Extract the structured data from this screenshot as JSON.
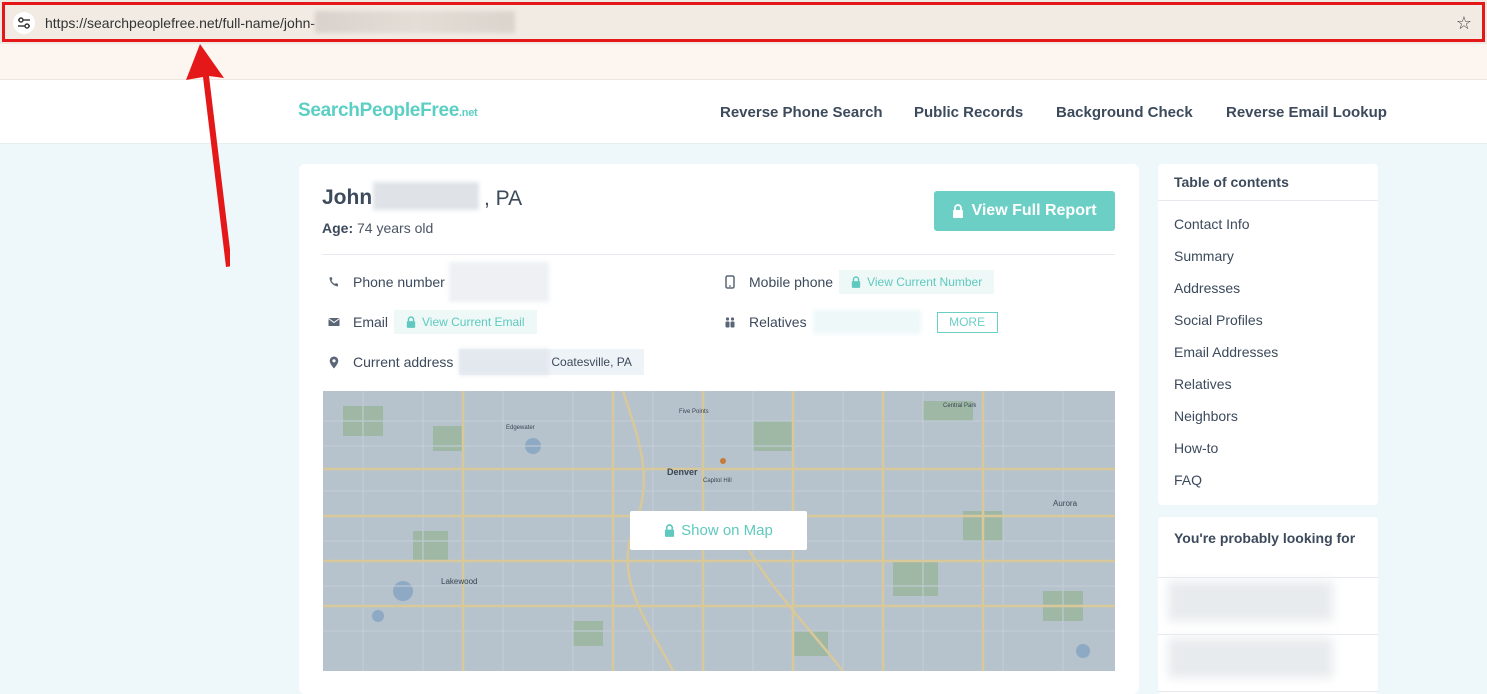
{
  "browser": {
    "url_visible": "https://searchpeoplefree.net/full-name/john-",
    "site_info_icon": "tune-icon",
    "bookmark_icon": "star-icon"
  },
  "site": {
    "logo_main": "SearchPeopleFree",
    "logo_tld": ".net",
    "nav": [
      "Reverse Phone Search",
      "Public Records",
      "Background Check",
      "Reverse Email Lookup"
    ]
  },
  "person": {
    "first_name": "John",
    "state": ", PA",
    "age_label": "Age:",
    "age_value": "74 years old",
    "view_report_label": "View Full Report",
    "phone_label": "Phone number",
    "mobile_label": "Mobile phone",
    "mobile_action": "View Current Number",
    "email_label": "Email",
    "email_action": "View Current Email",
    "relatives_label": "Relatives",
    "more_label": "MORE",
    "address_label": "Current address",
    "address_city": "Coatesville, PA"
  },
  "map": {
    "show_label": "Show on Map",
    "labels": [
      "Denver",
      "Lakewood",
      "Aurora",
      "Edgewater",
      "Capitol Hill",
      "Five Points",
      "Central Park"
    ]
  },
  "toc": {
    "title": "Table of contents",
    "items": [
      "Contact Info",
      "Summary",
      "Addresses",
      "Social Profiles",
      "Email Addresses",
      "Relatives",
      "Neighbors",
      "How-to",
      "FAQ"
    ]
  },
  "looking_for": {
    "title": "You're probably looking for"
  },
  "colors": {
    "accent": "#6ccfc6",
    "annotation": "#e41818",
    "page_bg": "#eef8fa"
  }
}
